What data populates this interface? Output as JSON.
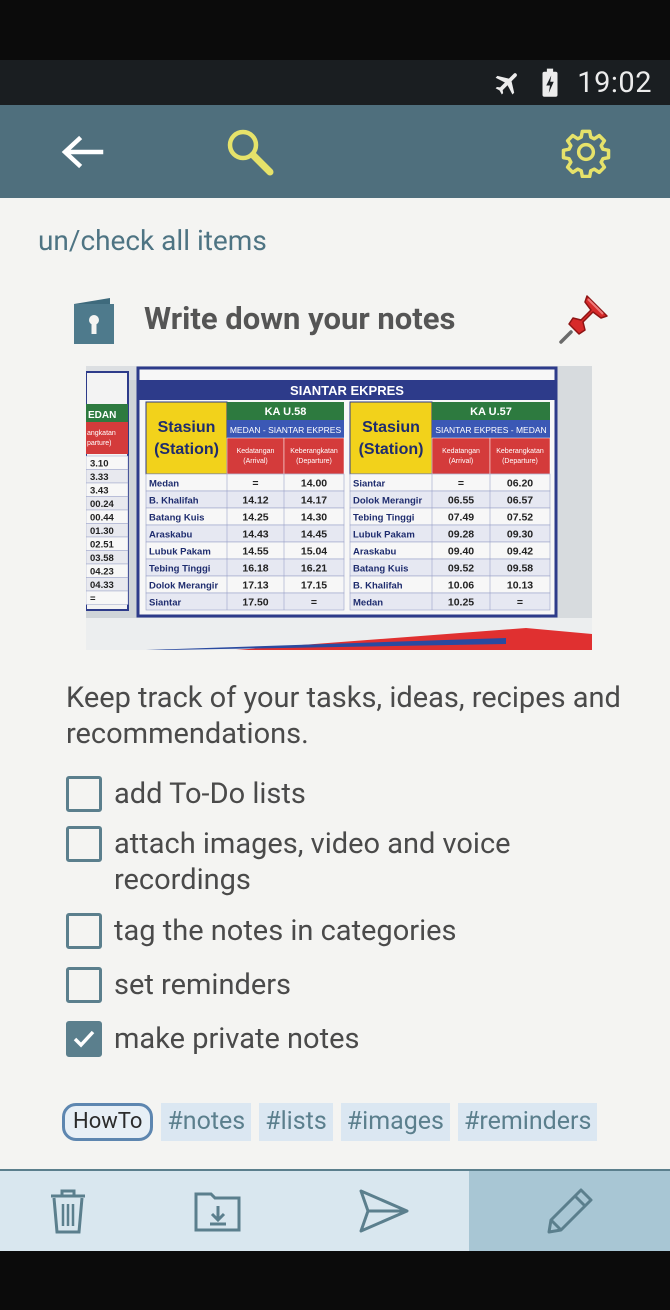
{
  "status_bar": {
    "airplane_icon": "airplane-icon",
    "battery_icon": "battery-charging-icon",
    "time": "19:02"
  },
  "app_bar": {
    "back_icon": "back-arrow-icon",
    "search_icon": "search-icon",
    "settings_icon": "gear-icon",
    "background": "#4f6f7d",
    "accent": "#e6e26a"
  },
  "note": {
    "check_all_label": "un/check all items",
    "title": "Write down your notes",
    "note_icon": "note-book-icon",
    "pin_icon": "pushpin-icon",
    "image": {
      "board_title": "SIANTAR EKPRES",
      "left_table": {
        "train": "KA U.58",
        "route": "MEDAN - SIANTAR EKPRES",
        "station_header_1": "Stasiun",
        "station_header_2": "(Station)",
        "arrival_header_1": "Kedatangan",
        "arrival_header_2": "(Arrival)",
        "departure_header_1": "Keberangkatan",
        "departure_header_2": "(Departure)",
        "rows": [
          {
            "station": "Medan",
            "arrival": "=",
            "departure": "14.00"
          },
          {
            "station": "B. Khalifah",
            "arrival": "14.12",
            "departure": "14.17"
          },
          {
            "station": "Batang Kuis",
            "arrival": "14.25",
            "departure": "14.30"
          },
          {
            "station": "Araskabu",
            "arrival": "14.43",
            "departure": "14.45"
          },
          {
            "station": "Lubuk Pakam",
            "arrival": "14.55",
            "departure": "15.04"
          },
          {
            "station": "Tebing Tinggi",
            "arrival": "16.18",
            "departure": "16.21"
          },
          {
            "station": "Dolok Merangir",
            "arrival": "17.13",
            "departure": "17.15"
          },
          {
            "station": "Siantar",
            "arrival": "17.50",
            "departure": "="
          }
        ]
      },
      "right_table": {
        "train": "KA U.57",
        "route": "SIANTAR EKPRES - MEDAN",
        "station_header_1": "Stasiun",
        "station_header_2": "(Station)",
        "arrival_header_1": "Kedatangan",
        "arrival_header_2": "(Arrival)",
        "departure_header_1": "Keberangkatan",
        "departure_header_2": "(Departure)",
        "rows": [
          {
            "station": "Siantar",
            "arrival": "=",
            "departure": "06.20"
          },
          {
            "station": "Dolok Merangir",
            "arrival": "06.55",
            "departure": "06.57"
          },
          {
            "station": "Tebing Tinggi",
            "arrival": "07.49",
            "departure": "07.52"
          },
          {
            "station": "Lubuk Pakam",
            "arrival": "09.28",
            "departure": "09.30"
          },
          {
            "station": "Araskabu",
            "arrival": "09.40",
            "departure": "09.42"
          },
          {
            "station": "Batang Kuis",
            "arrival": "09.52",
            "departure": "09.58"
          },
          {
            "station": "B. Khalifah",
            "arrival": "10.06",
            "departure": "10.13"
          },
          {
            "station": "Medan",
            "arrival": "10.25",
            "departure": "="
          }
        ]
      },
      "edge_table": {
        "header_1": "EDAN",
        "header_2": "angkatan",
        "header_3": "parture)",
        "values": [
          "3.10",
          "3.33",
          "3.43",
          "00.24",
          "00.44",
          "01.30",
          "02.51",
          "03.58",
          "04.23",
          "04.33",
          "="
        ]
      }
    },
    "body": "Keep track of your tasks, ideas, recipes and recommendations.",
    "todos": [
      {
        "label": "add To-Do lists",
        "checked": false
      },
      {
        "label": "attach images, video and voice recordings",
        "checked": false
      },
      {
        "label": "tag the notes in categories",
        "checked": false
      },
      {
        "label": "set reminders",
        "checked": false
      },
      {
        "label": "make private notes",
        "checked": true
      }
    ],
    "category": "HowTo",
    "tags": [
      "#notes",
      "#lists",
      "#images",
      "#reminders"
    ]
  },
  "bottom_bar": {
    "delete_icon": "trash-icon",
    "archive_icon": "archive-folder-icon",
    "share_icon": "send-icon",
    "edit_icon": "pencil-icon"
  }
}
